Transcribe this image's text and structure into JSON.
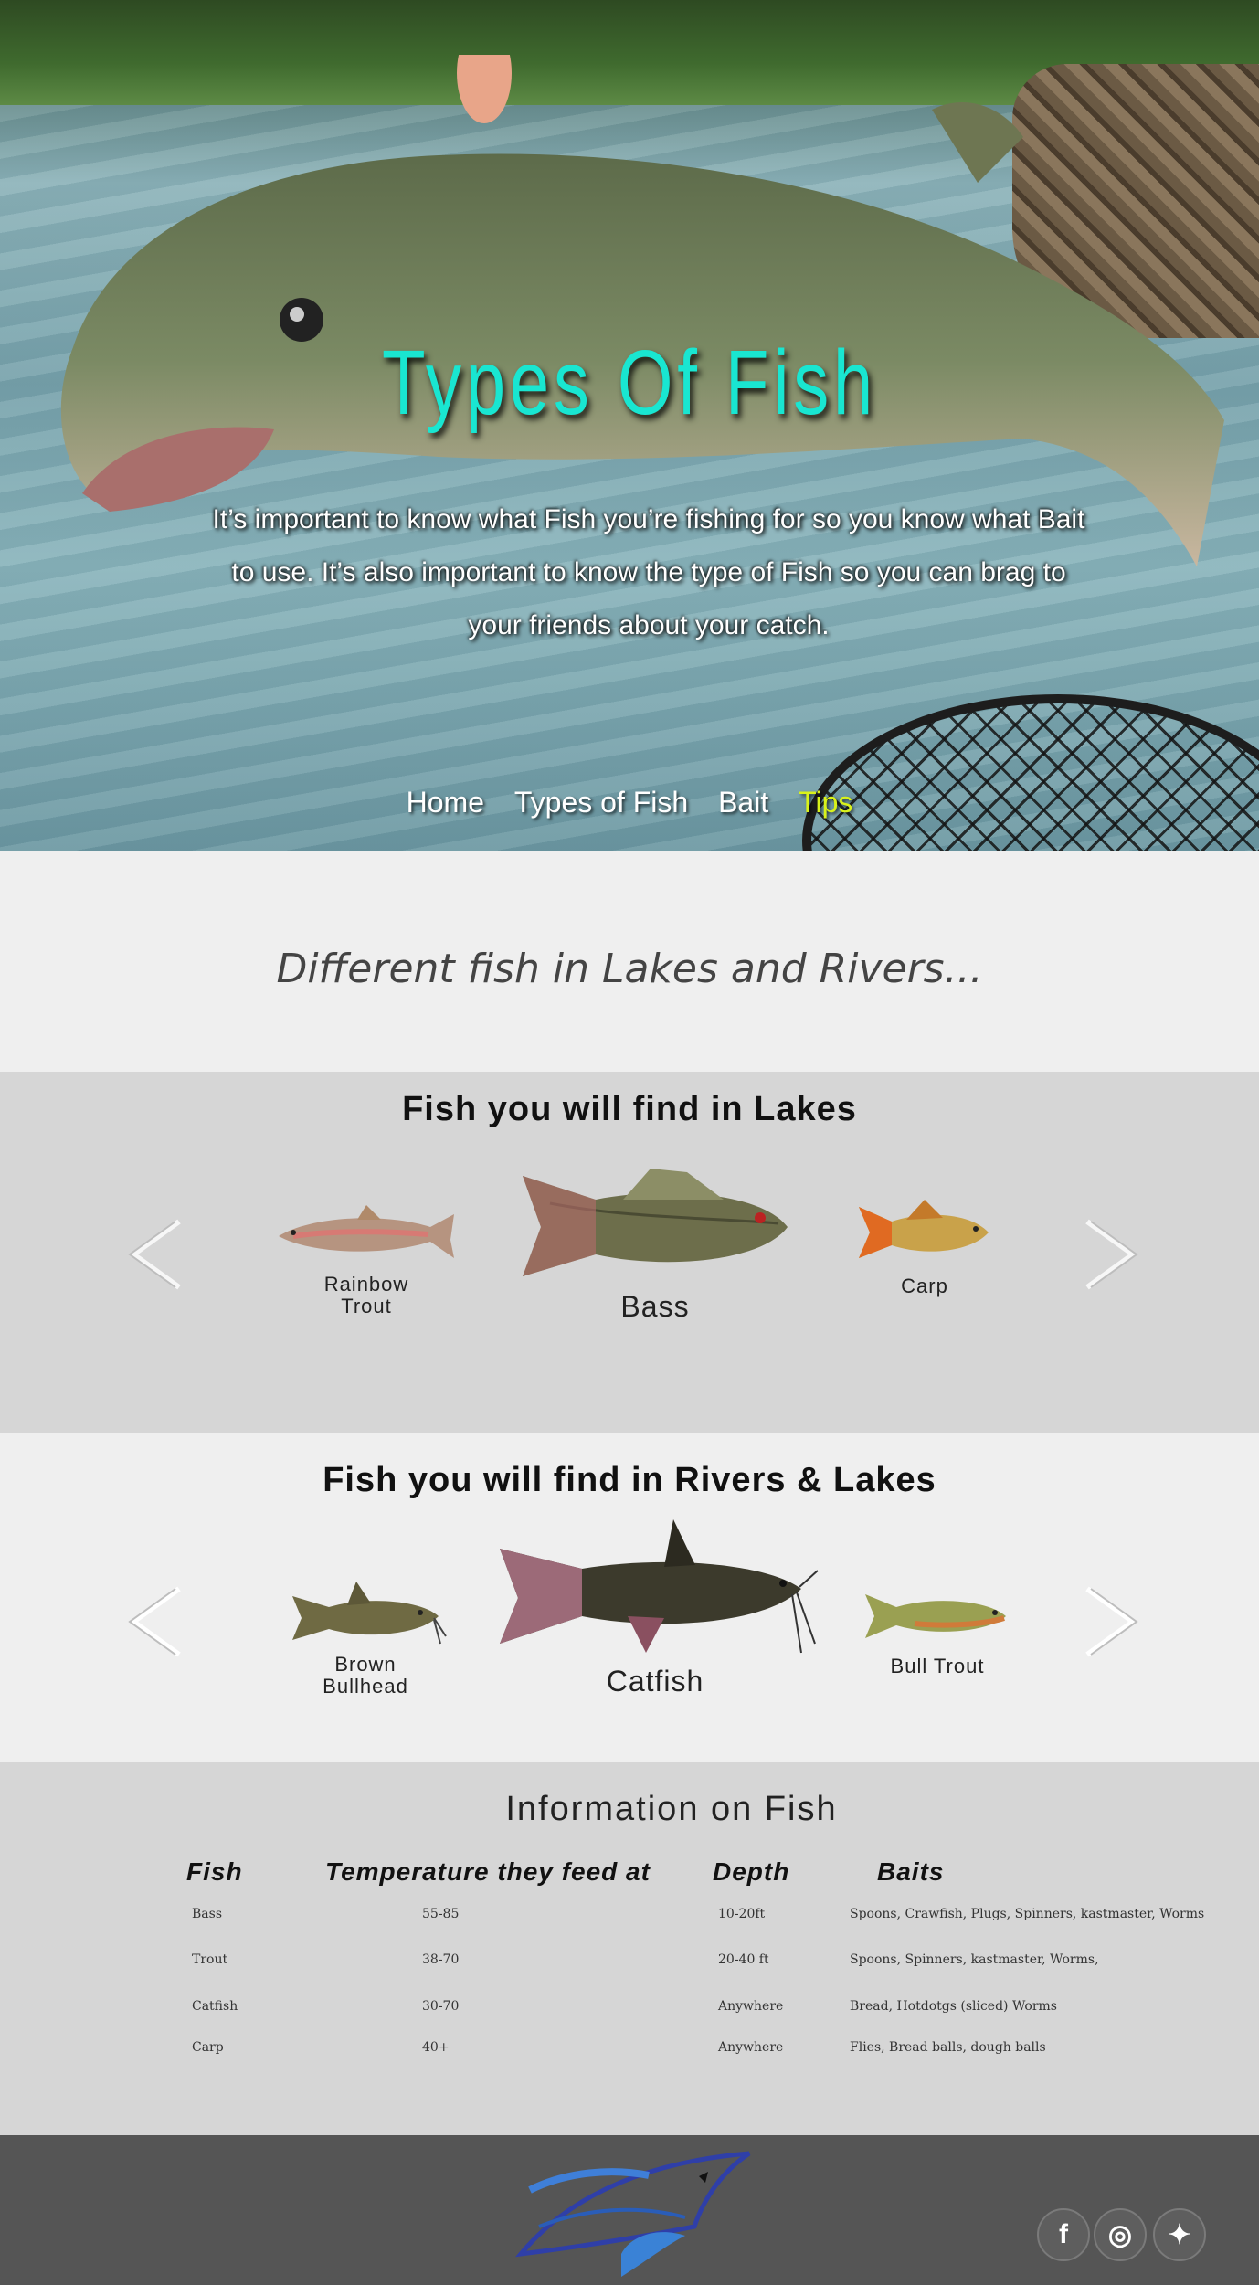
{
  "hero": {
    "title": "Types Of Fish",
    "intro": "It’s important to know what Fish you’re fishing for so you know what Bait to use. It’s also important to know the type of Fish so you can brag to your friends about your catch."
  },
  "nav": {
    "items": [
      {
        "label": "Home"
      },
      {
        "label": "Types of Fish"
      },
      {
        "label": "Bait"
      },
      {
        "label": "Tips",
        "active": true
      }
    ],
    "active_color": "#d9f21a"
  },
  "intro": {
    "subtitle": "Different fish in Lakes and Rivers..."
  },
  "lakes": {
    "heading": "Fish you will find in Lakes",
    "fish": [
      {
        "name": "Rainbow\nTrout"
      },
      {
        "name": "Bass"
      },
      {
        "name": "Carp"
      }
    ]
  },
  "rivers": {
    "heading": "Fish you will find in Rivers & Lakes",
    "fish": [
      {
        "name": "Brown\nBullhead"
      },
      {
        "name": "Catfish"
      },
      {
        "name": "Bull Trout"
      }
    ]
  },
  "info": {
    "heading": "Information on Fish",
    "columns": [
      "Fish",
      "Temperature they feed at",
      "Depth",
      "Baits"
    ],
    "rows": [
      [
        "Bass",
        "55-85",
        "10-20ft",
        "Spoons, Crawfish, Plugs, Spinners, kastmaster, Worms"
      ],
      [
        "Trout",
        "38-70",
        "20-40 ft",
        "Spoons, Spinners, kastmaster, Worms,"
      ],
      [
        "Catfish",
        "30-70",
        "Anywhere",
        "Bread, Hotdotgs (sliced)  Worms"
      ],
      [
        "Carp",
        "40+",
        "Anywhere",
        "Flies, Bread balls, dough balls"
      ]
    ]
  },
  "footer": {
    "social": [
      {
        "icon": "facebook-icon",
        "glyph": "f"
      },
      {
        "icon": "instagram-icon",
        "glyph": "◎"
      },
      {
        "icon": "twitter-icon",
        "glyph": "✦"
      }
    ]
  },
  "colors": {
    "title_teal": "#19e6d1",
    "band_gray": "#d6d6d6",
    "band_light": "#efefef",
    "footer_gray": "#555555"
  }
}
